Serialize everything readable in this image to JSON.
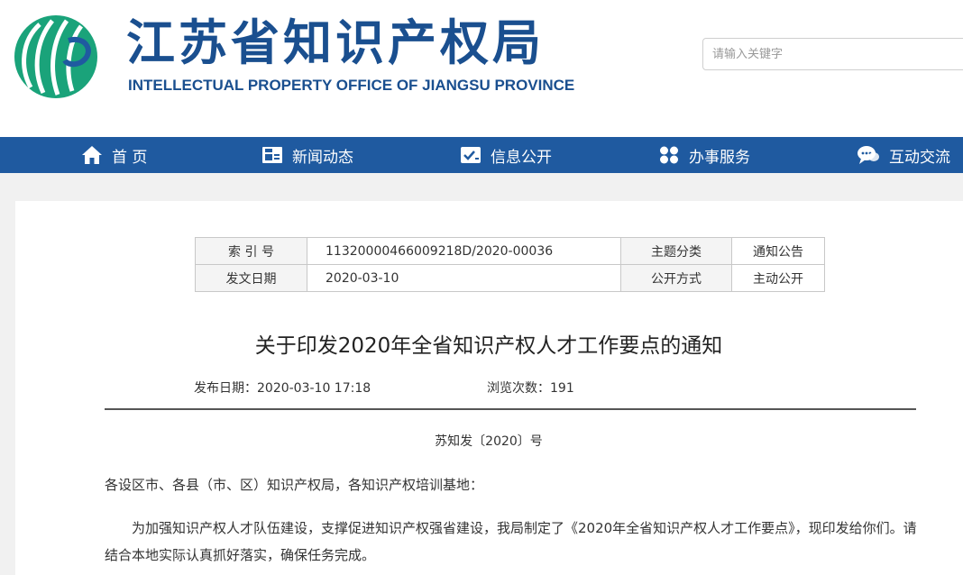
{
  "header": {
    "site_title": "江苏省知识产权局",
    "site_subtitle": "INTELLECTUAL PROPERTY OFFICE OF JIANGSU PROVINCE",
    "search": {
      "placeholder": "请输入关键字"
    },
    "logo_color": "#1aa37a"
  },
  "nav": {
    "background": "#1f5aa0",
    "items": [
      {
        "label": "首 页",
        "icon": "home-icon"
      },
      {
        "label": "新闻动态",
        "icon": "newspaper-icon"
      },
      {
        "label": "信息公开",
        "icon": "check-card-icon"
      },
      {
        "label": "办事服务",
        "icon": "grid-circles-icon"
      },
      {
        "label": "互动交流",
        "icon": "chat-bubbles-icon"
      }
    ]
  },
  "meta": {
    "index_label": "索 引 号",
    "index_value": "11320000466009218D/2020-00036",
    "topic_label": "主题分类",
    "topic_value": "通知公告",
    "date_label": "发文日期",
    "date_value": "2020-03-10",
    "method_label": "公开方式",
    "method_value": "主动公开"
  },
  "article": {
    "title": "关于印发2020年全省知识产权人才工作要点的通知",
    "publish_date": "发布日期：2020-03-10 17:18",
    "views": "浏览次数：191",
    "doc_number": "苏知发〔2020〕号",
    "salutation": "各设区市、各县（市、区）知识产权局，各知识产权培训基地：",
    "paragraph": "为加强知识产权人才队伍建设，支撑促进知识产权强省建设，我局制定了《2020年全省知识产权人才工作要点》，现印发给你们。请结合本地实际认真抓好落实，确保任务完成。"
  }
}
